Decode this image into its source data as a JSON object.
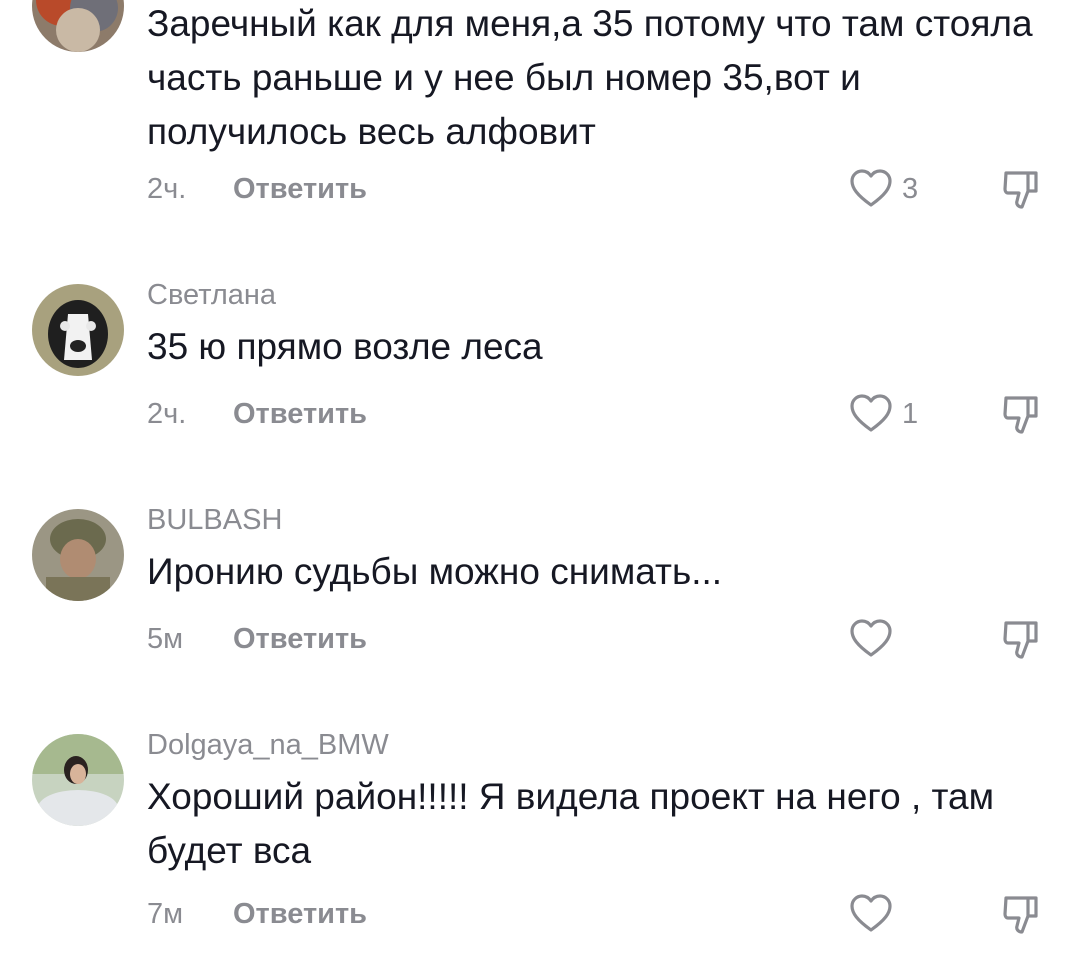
{
  "comments": [
    {
      "username": "",
      "text": "Заречный как для меня,а 35 потому что там стояла часть раньше и у нее был номер 35,вот и получилось весь алфовит",
      "time": "2ч.",
      "reply_label": "Ответить",
      "likes": "3",
      "avatar_icon": "avatar-photo"
    },
    {
      "username": "Светлана",
      "text": "35 ю прямо возле леса",
      "time": "2ч.",
      "reply_label": "Ответить",
      "likes": "1",
      "avatar_icon": "dog-photo"
    },
    {
      "username": "BULBASH",
      "text": "Иронию судьбы можно снимать...",
      "time": "5м",
      "reply_label": "Ответить",
      "likes": "",
      "avatar_icon": "soldier-photo"
    },
    {
      "username": "Dolgaya_na_BMW",
      "text": "Хороший район!!!!! Я видела проект на него , там будет вса",
      "time": "7м",
      "reply_label": "Ответить",
      "likes": "",
      "avatar_icon": "woman-photo"
    }
  ],
  "colors": {
    "text": "#161823",
    "secondary": "#8a8b91"
  },
  "icons": {
    "like": "heart-outline-icon",
    "dislike": "thumbs-down-outline-icon"
  }
}
